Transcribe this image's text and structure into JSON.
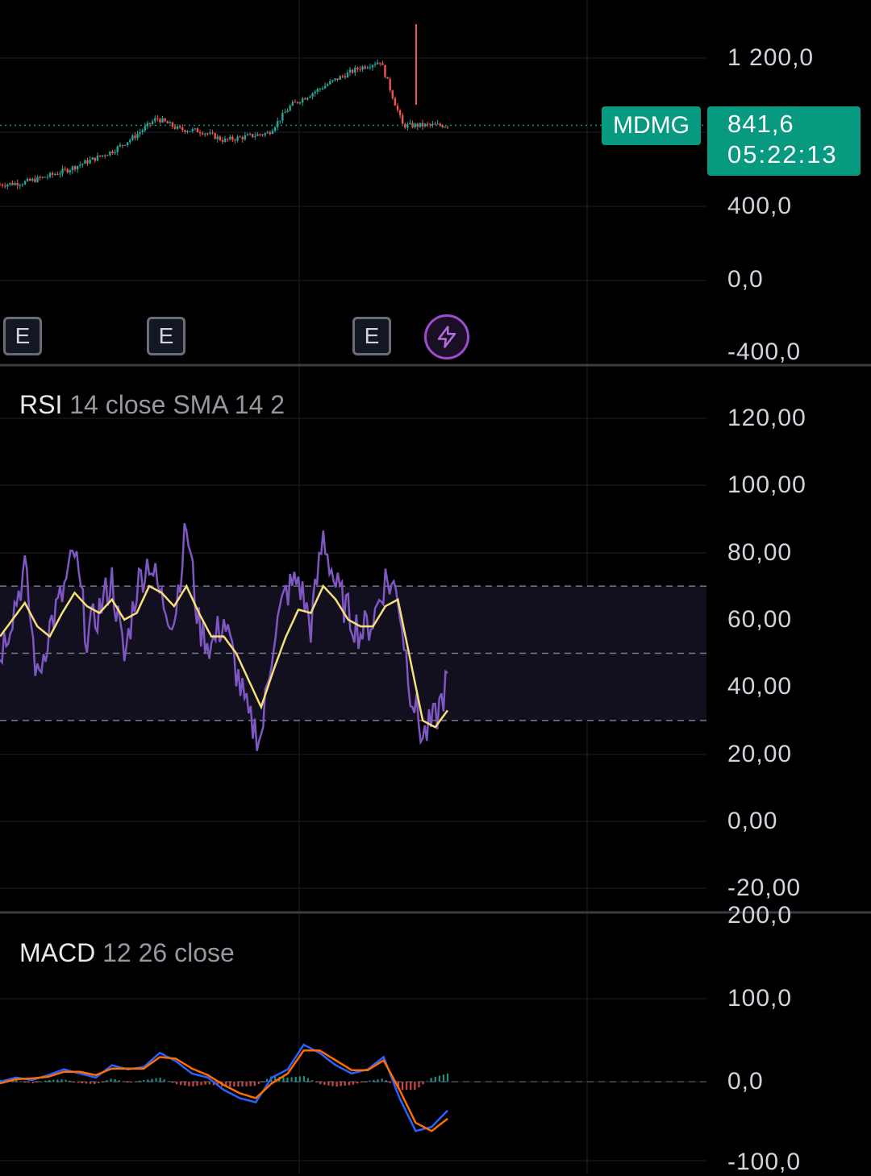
{
  "symbol": "MDMG",
  "last_price": "841,6",
  "countdown": "05:22:13",
  "colors": {
    "up": "#26a69a",
    "down": "#ef5350",
    "rsi": "#7e57c2",
    "rsi_ma": "#f5e07a",
    "macd": "#2962ff",
    "signal": "#ff6d00",
    "accent": "#089981",
    "event_bolt": "#9c4dcc"
  },
  "events": [
    {
      "type": "earnings",
      "label": "E"
    },
    {
      "type": "earnings",
      "label": "E"
    },
    {
      "type": "earnings",
      "label": "E"
    },
    {
      "type": "bolt-icon",
      "label": ""
    }
  ],
  "price_pane": {
    "axis_labels": [
      "1 200,0",
      "400,0",
      "0,0",
      "-400,0"
    ]
  },
  "rsi_pane": {
    "name": "RSI",
    "params": "14 close SMA 14 2",
    "axis_labels": [
      "120,00",
      "100,00",
      "80,00",
      "60,00",
      "40,00",
      "20,00",
      "0,00",
      "-20,00"
    ]
  },
  "macd_pane": {
    "name": "MACD",
    "params": "12 26 close",
    "axis_labels": [
      "200,0",
      "100,0",
      "0,0",
      "-100,0"
    ]
  },
  "chart_data": [
    {
      "type": "candlestick",
      "ylim": [
        -400,
        1200
      ],
      "price_trace": [
        520,
        530,
        560,
        600,
        650,
        700,
        780,
        880,
        820,
        810,
        760,
        780,
        800,
        950,
        1020,
        1090,
        1150,
        1190,
        840,
        842,
        841.6
      ],
      "last": 841.6
    },
    {
      "type": "line",
      "ylim": [
        -20,
        120
      ],
      "bands": {
        "upper": 70,
        "middle": 50,
        "lower": 30
      },
      "series": [
        {
          "name": "RSI",
          "values": [
            50,
            62,
            75,
            42,
            58,
            67,
            80,
            55,
            63,
            72,
            48,
            70,
            78,
            66,
            60,
            88,
            58,
            52,
            60,
            45,
            30,
            25,
            55,
            68,
            72,
            58,
            85,
            70,
            62,
            56,
            60,
            72,
            68,
            40,
            25,
            30,
            42
          ]
        },
        {
          "name": "SMA",
          "values": [
            55,
            60,
            65,
            58,
            55,
            62,
            68,
            64,
            62,
            66,
            60,
            62,
            70,
            68,
            64,
            70,
            62,
            55,
            55,
            50,
            42,
            34,
            45,
            55,
            63,
            62,
            70,
            66,
            60,
            58,
            58,
            64,
            66,
            48,
            30,
            28,
            33
          ]
        }
      ]
    },
    {
      "type": "line",
      "ylim": [
        -100,
        200
      ],
      "series": [
        {
          "name": "MACD",
          "values": [
            0,
            5,
            2,
            8,
            15,
            10,
            5,
            20,
            15,
            18,
            35,
            25,
            10,
            5,
            -10,
            -20,
            -25,
            5,
            15,
            45,
            35,
            20,
            10,
            15,
            30,
            -20,
            -60,
            -55,
            -35
          ]
        },
        {
          "name": "Signal",
          "values": [
            -2,
            3,
            4,
            6,
            12,
            12,
            8,
            16,
            16,
            16,
            30,
            28,
            16,
            8,
            -4,
            -14,
            -20,
            -2,
            10,
            38,
            38,
            26,
            14,
            14,
            26,
            -10,
            -50,
            -60,
            -45
          ]
        }
      ]
    }
  ]
}
